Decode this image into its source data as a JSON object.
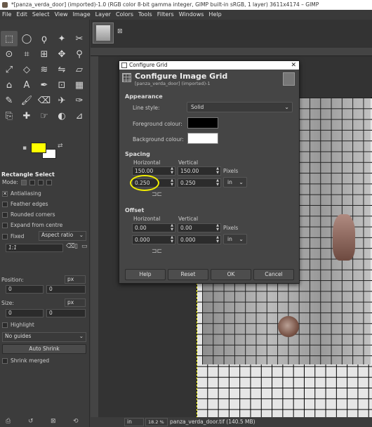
{
  "window": {
    "title": "*[panza_verda_door] (imported)-1.0 (RGB color 8-bit gamma integer, GIMP built-in sRGB, 1 layer) 3611x4174 – GIMP"
  },
  "menu": [
    "File",
    "Edit",
    "Select",
    "View",
    "Image",
    "Layer",
    "Colors",
    "Tools",
    "Filters",
    "Windows",
    "Help"
  ],
  "toolbox": {
    "tools": [
      "rect-select-icon",
      "ellipse-select-icon",
      "free-select-icon",
      "fuzzy-select-icon",
      "scissors-icon",
      "foreground-select-icon",
      "crop-icon",
      "align-icon",
      "move-icon",
      "zoom-icon",
      "transform-icon",
      "unified-transform-icon",
      "warp-icon",
      "flip-icon",
      "perspective-icon",
      "cage-icon",
      "text-icon",
      "paths-icon",
      "bucket-fill-icon",
      "gradient-icon",
      "pencil-icon",
      "paintbrush-icon",
      "eraser-icon",
      "airbrush-icon",
      "ink-icon",
      "clone-icon",
      "heal-icon",
      "smudge-icon",
      "dodge-icon",
      "measure-icon"
    ],
    "glyphs": [
      "⬚",
      "◯",
      "ϙ",
      "✦",
      "✂",
      "⊙",
      "⌗",
      "⊞",
      "✥",
      "⚲",
      "⤢",
      "◇",
      "≋",
      "⇋",
      "▱",
      "⌂",
      "A",
      "✒",
      "⊡",
      "▦",
      "✎",
      "🖌",
      "⌫",
      "✈",
      "✑",
      "⎘",
      "✚",
      "☞",
      "◐",
      "⊿"
    ],
    "fg_color": "#ffff00",
    "bg_color": "#ffffff"
  },
  "tool_options": {
    "title": "Rectangle Select",
    "mode_label": "Mode:",
    "antialiasing": "Antialiasing",
    "feather": "Feather edges",
    "rounded": "Rounded corners",
    "expand": "Expand from centre",
    "fixed": "Fixed",
    "fixed_value": "Aspect ratio",
    "ratio": "1:1",
    "position_label": "Position:",
    "position_unit": "px",
    "pos_x": "0",
    "pos_y": "0",
    "size_label": "Size:",
    "size_unit": "px",
    "size_w": "0",
    "size_h": "0",
    "highlight": "Highlight",
    "guides": "No guides",
    "autoshrink": "Auto Shrink",
    "shrink_merged": "Shrink merged"
  },
  "status": {
    "unit": "in",
    "zoom": "18.2 %",
    "file": "panza_verda_door.tif (140.5 MB)"
  },
  "dialog": {
    "window_title": "Configure Grid",
    "heading": "Configure Image Grid",
    "subheading": "[panza_verda_door] (imported)-1",
    "appearance": "Appearance",
    "line_style_label": "Line style:",
    "line_style": "Solid",
    "fg_label": "Foreground colour:",
    "bg_label": "Background colour:",
    "fg_color": "#000000",
    "bg_color": "#ffffff",
    "spacing": "Spacing",
    "horizontal": "Horizontal",
    "vertical": "Vertical",
    "spacing_h_px": "150.00",
    "spacing_v_px": "150.00",
    "pixels": "Pixels",
    "spacing_h_in": "0.250",
    "spacing_v_in": "0.250",
    "unit": "in",
    "offset": "Offset",
    "offset_horizontal": "Horizontal",
    "offset_vertical": "Vertical",
    "offset_h_px": "0.00",
    "offset_v_px": "0.00",
    "offset_pixels": "Pixels",
    "offset_h_in": "0.000",
    "offset_v_in": "0.000",
    "offset_unit": "in",
    "buttons": {
      "help": "Help",
      "reset": "Reset",
      "ok": "OK",
      "cancel": "Cancel"
    }
  }
}
